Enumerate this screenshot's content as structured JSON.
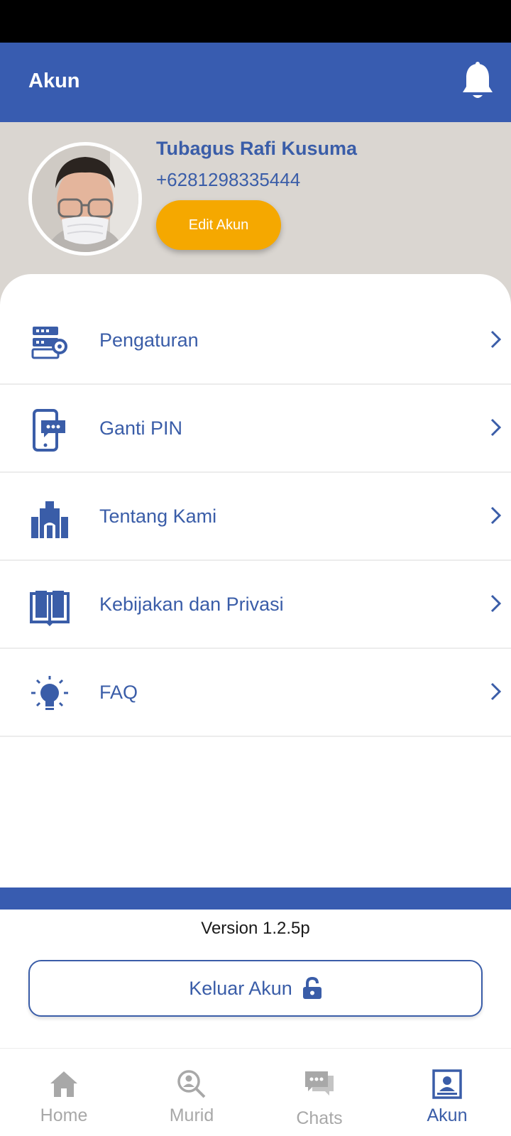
{
  "header": {
    "title": "Akun",
    "notification_icon": "bell-icon"
  },
  "profile": {
    "name": "Tubagus Rafi Kusuma",
    "phone": "+6281298335444",
    "edit_label": "Edit Akun"
  },
  "menu": [
    {
      "label": "Pengaturan",
      "icon": "settings-server-icon"
    },
    {
      "label": "Ganti PIN",
      "icon": "phone-pin-icon"
    },
    {
      "label": "Tentang Kami",
      "icon": "building-icon"
    },
    {
      "label": "Kebijakan dan Privasi",
      "icon": "book-icon"
    },
    {
      "label": "FAQ",
      "icon": "lightbulb-icon"
    }
  ],
  "footer": {
    "version": "Version 1.2.5p",
    "logout_label": "Keluar Akun"
  },
  "bottom_nav": [
    {
      "label": "Home",
      "icon": "home-icon",
      "active": false
    },
    {
      "label": "Murid",
      "icon": "search-user-icon",
      "active": false
    },
    {
      "label": "Chats",
      "icon": "chat-icon",
      "active": false
    },
    {
      "label": "Akun",
      "icon": "account-icon",
      "active": true
    }
  ],
  "colors": {
    "primary": "#385CB0",
    "accent": "#F5A800",
    "profile_bg": "#DAD6D1",
    "inactive": "#A8A8A8"
  }
}
